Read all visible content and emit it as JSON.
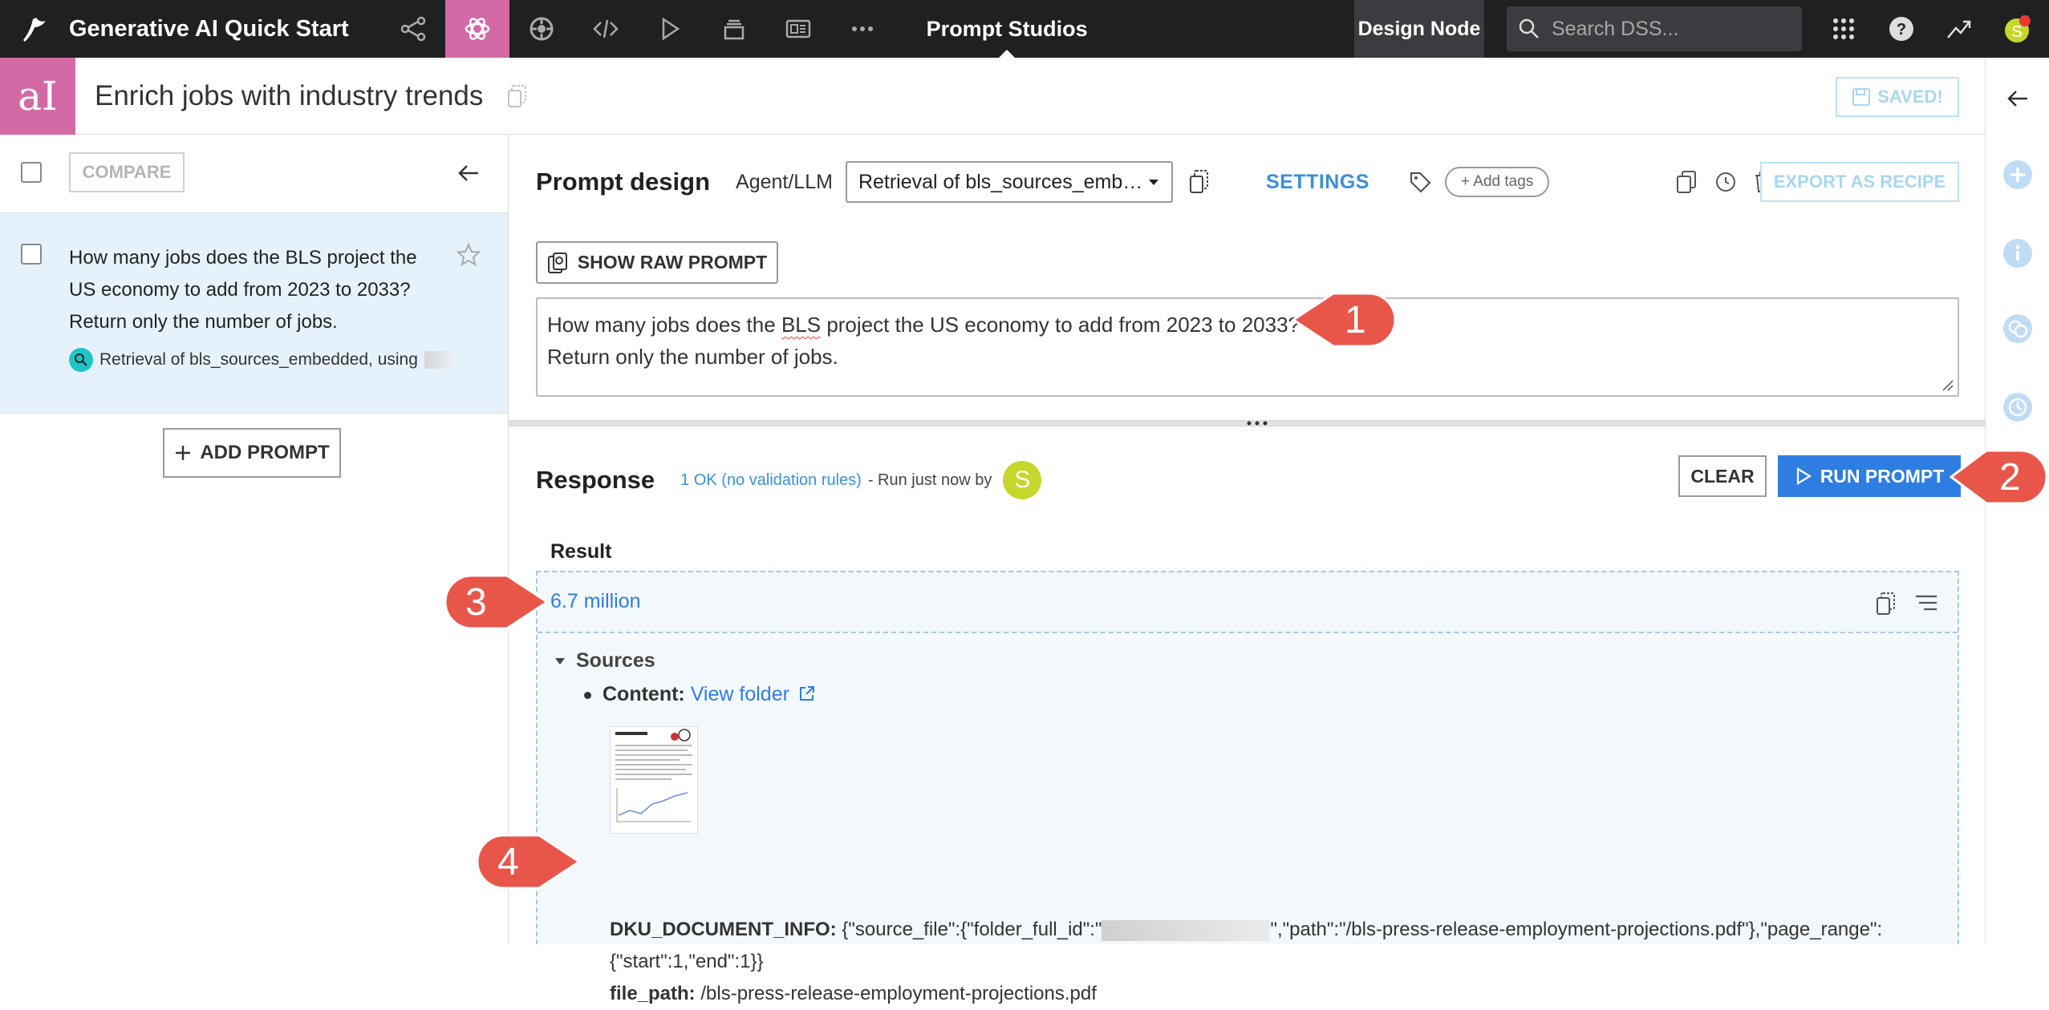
{
  "topnav": {
    "project_title": "Generative AI Quick Start",
    "studio_title": "Prompt Studios",
    "design_node": "Design Node",
    "search_placeholder": "Search DSS...",
    "icons": [
      "flow-icon",
      "lab-icon",
      "code-icon",
      "play-icon",
      "stack-icon",
      "dashboard-icon",
      "more-icon"
    ]
  },
  "titlebar": {
    "logo_text": "aI",
    "title": "Enrich jobs with industry trends",
    "saved_label": "SAVED!"
  },
  "sidebar": {
    "compare_label": "COMPARE",
    "prompt_text": "How many jobs does the BLS project the US economy to add from 2023 to 2033? Return only the number of jobs.",
    "prompt_meta": "Retrieval of bls_sources_embedded, using",
    "add_prompt_label": "ADD PROMPT"
  },
  "prompt_design": {
    "title": "Prompt design",
    "agent_label": "Agent/LLM",
    "agent_value": "Retrieval of bls_sources_emb…",
    "settings_label": "SETTINGS",
    "tag_label": "+ Add tags",
    "export_label": "EXPORT AS RECIPE",
    "raw_prompt_label": "SHOW RAW PROMPT",
    "prompt_before": "How many jobs does the ",
    "prompt_spell": "BLS",
    "prompt_after": " project the US economy to add from 2023 to 2033?",
    "prompt_line2": "Return only the number of jobs."
  },
  "response": {
    "title": "Response",
    "status": "1 OK (no validation rules)",
    "run_info": "- Run just now  by",
    "avatar_letter": "S",
    "clear_label": "CLEAR",
    "run_label": "RUN PROMPT",
    "result_label": "Result",
    "result_value": "6.7 million",
    "sources_label": "Sources",
    "content_label": "Content:",
    "content_link": "View folder",
    "docinfo_label": "DKU_DOCUMENT_INFO:",
    "docinfo_part1": "{\"source_file\":{\"folder_full_id\":\"",
    "docinfo_part2": "\",\"path\":\"/bls-press-release-employment-projections.pdf\"},\"page_range\":",
    "docinfo_part3": "{\"start\":1,\"end\":1}}",
    "filepath_label": "file_path:",
    "filepath_value": "/bls-press-release-employment-projections.pdf"
  },
  "callouts": [
    "1",
    "2",
    "3",
    "4"
  ],
  "colors": {
    "accent_pink": "#d36aa5",
    "accent_blue": "#2e7de1",
    "callout_red": "#e8564a",
    "topbar": "#1f2022"
  }
}
